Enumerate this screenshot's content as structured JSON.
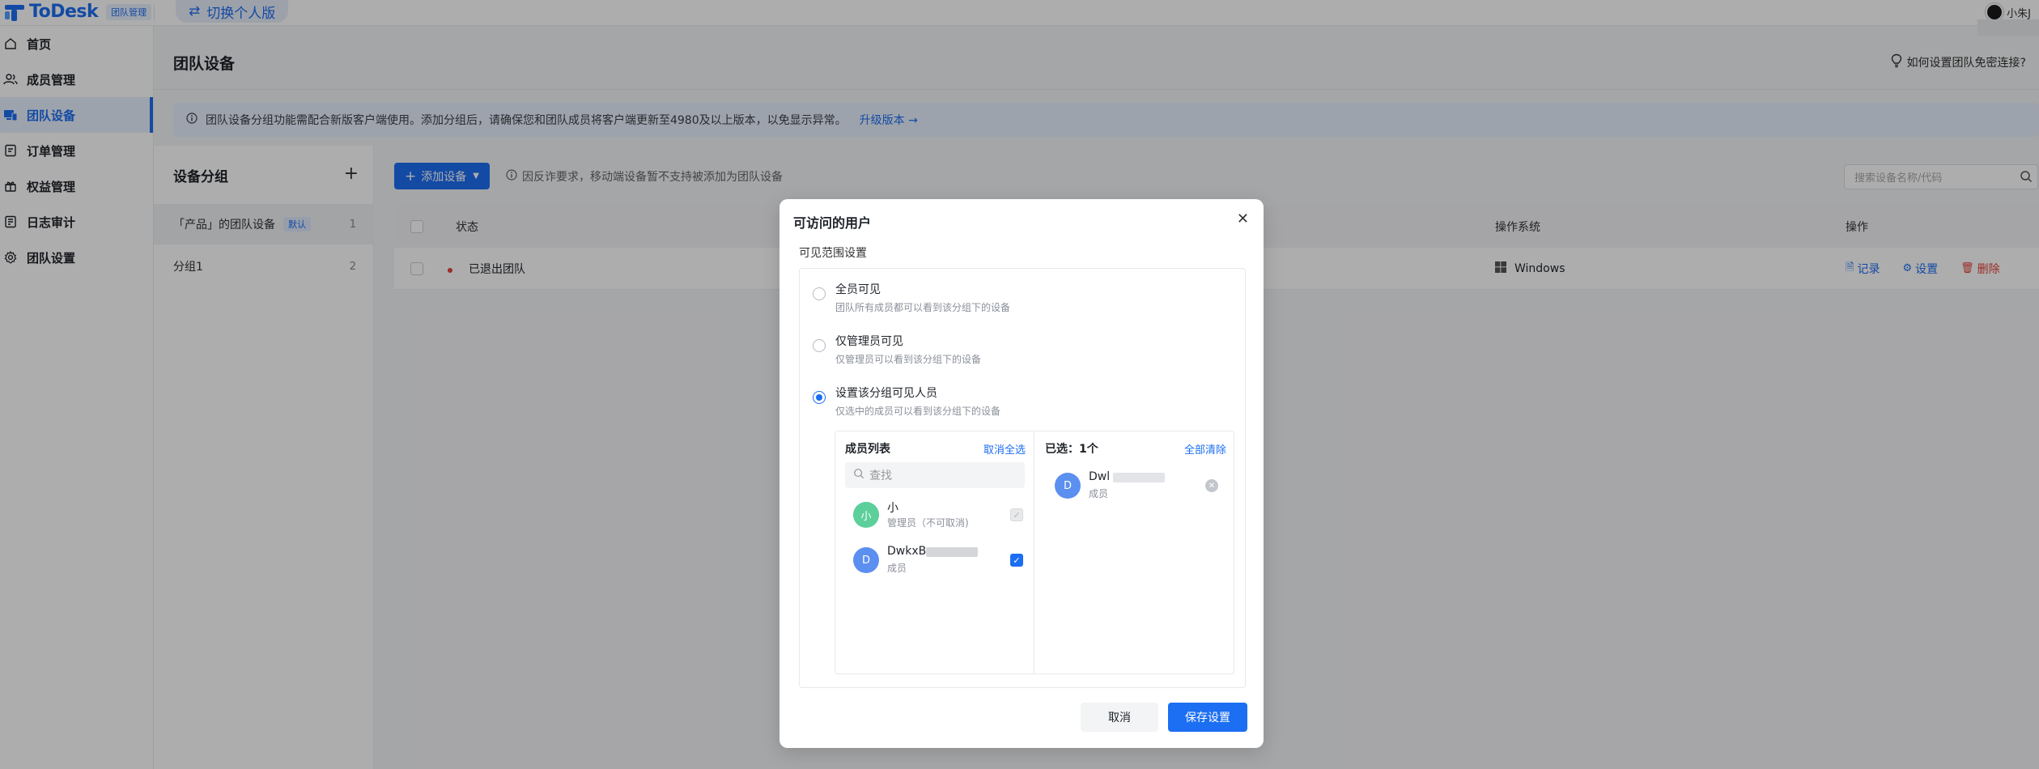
{
  "topbar": {
    "logo_text": "ToDesk",
    "badge": "团队管理",
    "switch_label": "切换个人版",
    "username": "小朱J"
  },
  "sidebar": {
    "items": [
      {
        "label": "首页",
        "icon": "home-icon"
      },
      {
        "label": "成员管理",
        "icon": "users-icon"
      },
      {
        "label": "团队设备",
        "icon": "devices-icon",
        "active": true
      },
      {
        "label": "订单管理",
        "icon": "order-icon"
      },
      {
        "label": "权益管理",
        "icon": "benefit-icon"
      },
      {
        "label": "日志审计",
        "icon": "log-icon"
      },
      {
        "label": "团队设置",
        "icon": "gear-icon"
      }
    ]
  },
  "header": {
    "title": "团队设备",
    "help": "如何设置团队免密连接?"
  },
  "notice": {
    "text": "团队设备分组功能需配合新版客户端使用。添加分组后，请确保您和团队成员将客户端更新至4980及以上版本，以免显示异常。",
    "upgrade": "升级版本 →"
  },
  "groups": {
    "title": "设备分组",
    "items": [
      {
        "name": "「产品」的团队设备",
        "tag": "默认",
        "count": "1"
      },
      {
        "name": "分组1",
        "count": "2"
      }
    ]
  },
  "toolbar": {
    "add_label": "添加设备",
    "tip": "因反诈要求，移动端设备暂不支持被添加为团队设备",
    "search_placeholder": "搜索设备名称/代码"
  },
  "table": {
    "headers": {
      "status": "状态",
      "os": "操作系统",
      "ops": "操作"
    },
    "row": {
      "status": "已退出团队",
      "os": "Windows",
      "op_record": "记录",
      "op_settings": "设置",
      "op_delete": "删除"
    }
  },
  "modal": {
    "title": "可访问的用户",
    "scope_label": "可见范围设置",
    "options": [
      {
        "title": "全员可见",
        "desc": "团队所有成员都可以看到该分组下的设备",
        "selected": false
      },
      {
        "title": "仅管理员可见",
        "desc": "仅管理员可以看到该分组下的设备",
        "selected": false
      },
      {
        "title": "设置该分组可见人员",
        "desc": "仅选中的成员可以看到该分组下的设备",
        "selected": true
      }
    ],
    "member_list": {
      "title": "成员列表",
      "action": "取消全选",
      "search_placeholder": "查找",
      "members": [
        {
          "avatar": "小",
          "name": "小",
          "role": "管理员（不可取消)",
          "color": "#5ccf9a",
          "check": "disabled"
        },
        {
          "avatar": "D",
          "name": "DwkxB",
          "role": "成员",
          "color": "#5b8ff0",
          "check": "on"
        }
      ]
    },
    "selected": {
      "title": "已选：1个",
      "action": "全部清除",
      "members": [
        {
          "avatar": "D",
          "name": "Dwl",
          "role": "成员",
          "color": "#5b8ff0"
        }
      ]
    },
    "cancel": "取消",
    "save": "保存设置"
  },
  "colors": {
    "accent": "#1c6ef2",
    "danger": "#e5413a"
  }
}
